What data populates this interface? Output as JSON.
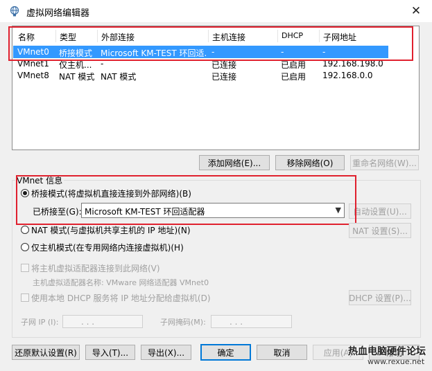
{
  "window": {
    "title": "虚拟网络编辑器",
    "close_label": "✕"
  },
  "network_list": {
    "columns": [
      "名称",
      "类型",
      "外部连接",
      "主机连接",
      "DHCP",
      "子网地址"
    ],
    "rows": [
      [
        "VMnet0",
        "桥接模式",
        "Microsoft KM-TEST 环回适...",
        "-",
        "-",
        "-"
      ],
      [
        "VMnet1",
        "仅主机...",
        "-",
        "已连接",
        "已启用",
        "192.168.198.0"
      ],
      [
        "VMnet8",
        "NAT 模式",
        "NAT 模式",
        "已连接",
        "已启用",
        "192.168.0.0"
      ]
    ],
    "selected_row": 0
  },
  "list_buttons": {
    "add": "添加网络(E)...",
    "remove": "移除网络(O)",
    "rename": "重命名网络(W)..."
  },
  "vmnet_info": {
    "group_label": "VMnet 信息",
    "bridged_label": "桥接模式(将虚拟机直接连接到外部网络)(B)",
    "bridged_to_label": "已桥接至(G):",
    "bridged_to_value": "Microsoft KM-TEST 环回适配器",
    "auto_settings": "自动设置(U)...",
    "nat_label": "NAT 模式(与虚拟机共享主机的 IP 地址)(N)",
    "nat_settings": "NAT 设置(S)...",
    "host_only_label": "仅主机模式(在专用网络内连接虚拟机)(H)",
    "connect_adapter_label": "将主机虚拟适配器连接到此网络(V)",
    "adapter_name_label": "主机虚拟适配器名称: VMware 网络适配器 VMnet0",
    "dhcp_label": "使用本地 DHCP 服务将 IP 地址分配给虚拟机(D)",
    "dhcp_settings": "DHCP 设置(P)...",
    "subnet_ip_label": "子网 IP (I):",
    "subnet_mask_label": "子网掩码(M):",
    "ip_dots": ".     .     ."
  },
  "footer_buttons": {
    "restore": "还原默认设置(R)",
    "import": "导入(T)...",
    "export": "导出(X)...",
    "ok": "确定",
    "cancel": "取消",
    "apply": "应用(A)",
    "help": "帮助"
  },
  "watermark": {
    "line1": "热血电脑硬件论坛",
    "line2": "www.rexue.net"
  },
  "colors": {
    "selection": "#3399ff",
    "highlight_box": "#e0202e",
    "default_button": "#0078d7"
  }
}
